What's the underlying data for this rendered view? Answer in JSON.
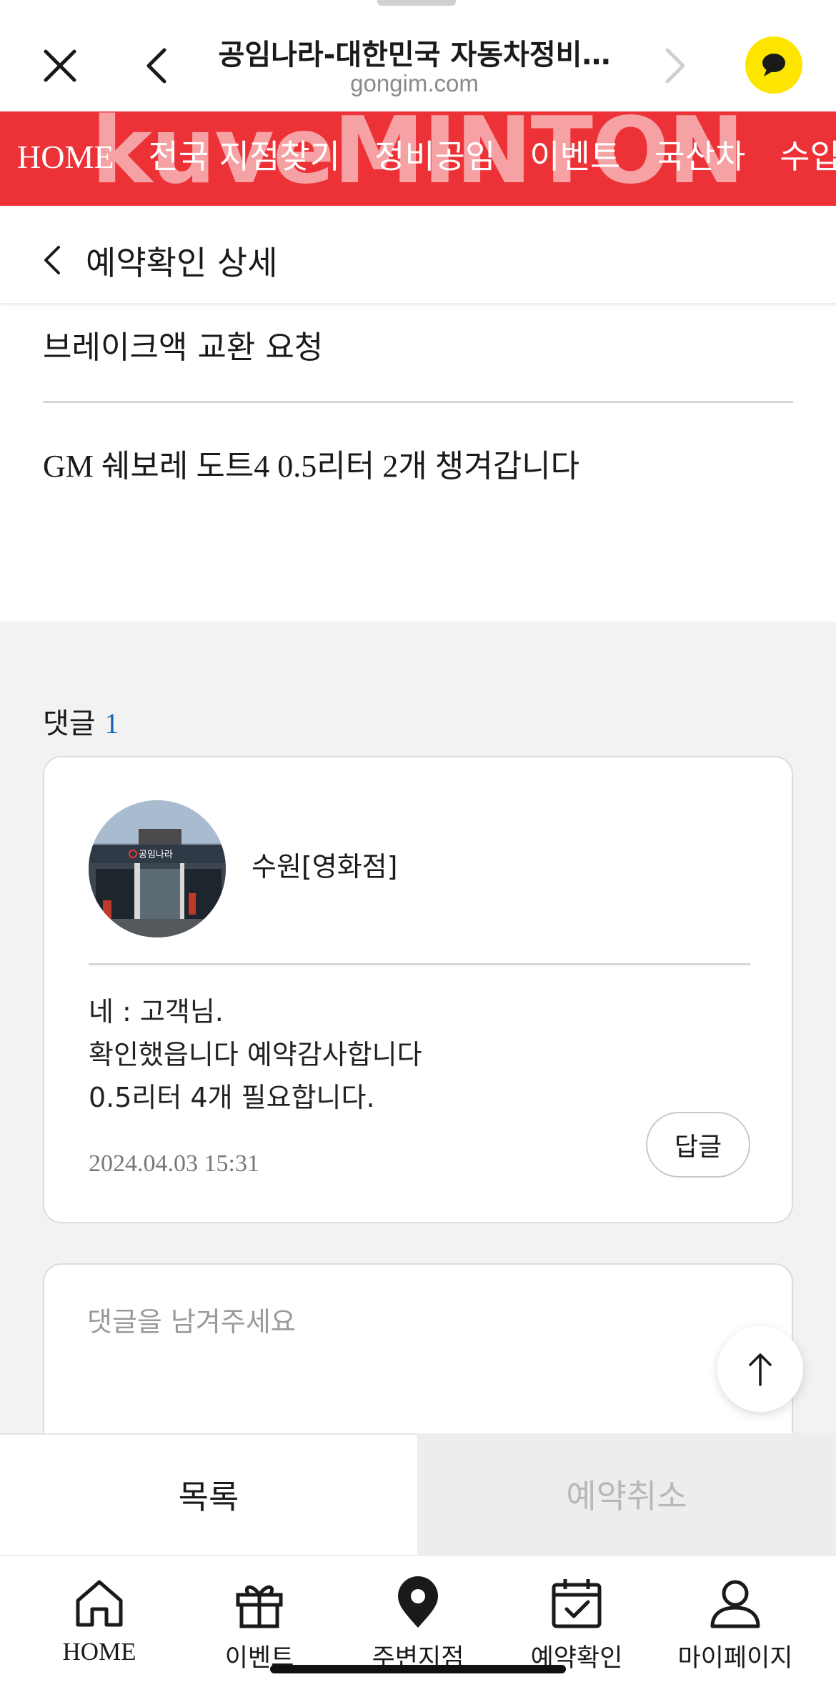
{
  "browser": {
    "title": "공임나라-대한민국 자동차정비…",
    "url": "gongim.com"
  },
  "watermark": "kuveMINTON",
  "top_nav": {
    "items": [
      "HOME",
      "전국 지점찾기",
      "정비공임",
      "이벤트",
      "국산차",
      "수입차"
    ]
  },
  "header": {
    "title": "예약확인 상세"
  },
  "post": {
    "subject": "브레이크액 교환 요청",
    "body": "GM 쉐보레 도트4 0.5리터 2개 챙겨갑니다"
  },
  "comments": {
    "label": "댓글",
    "count": "1",
    "items": [
      {
        "author": "수원[영화점]",
        "avatar_sign": "공임나라",
        "lines": [
          "네 : 고객님.",
          "확인했읍니다 예약감사합니다",
          "0.5리터 4개 필요합니다."
        ],
        "date": "2024.04.03 15:31",
        "reply_label": "답글"
      }
    ],
    "input_placeholder": "댓글을 남겨주세요"
  },
  "actions": {
    "list_label": "목록",
    "cancel_label": "예약취소"
  },
  "tab_bar": {
    "items": [
      {
        "label": "HOME",
        "icon": "home-icon"
      },
      {
        "label": "이벤트",
        "icon": "gift-icon"
      },
      {
        "label": "주변지점",
        "icon": "location-pin-icon"
      },
      {
        "label": "예약확인",
        "icon": "calendar-check-icon"
      },
      {
        "label": "마이페이지",
        "icon": "user-icon"
      }
    ]
  },
  "colors": {
    "brand_red": "#EC3237",
    "kakao_yellow": "#FEE500",
    "count_blue": "#1565c0"
  }
}
